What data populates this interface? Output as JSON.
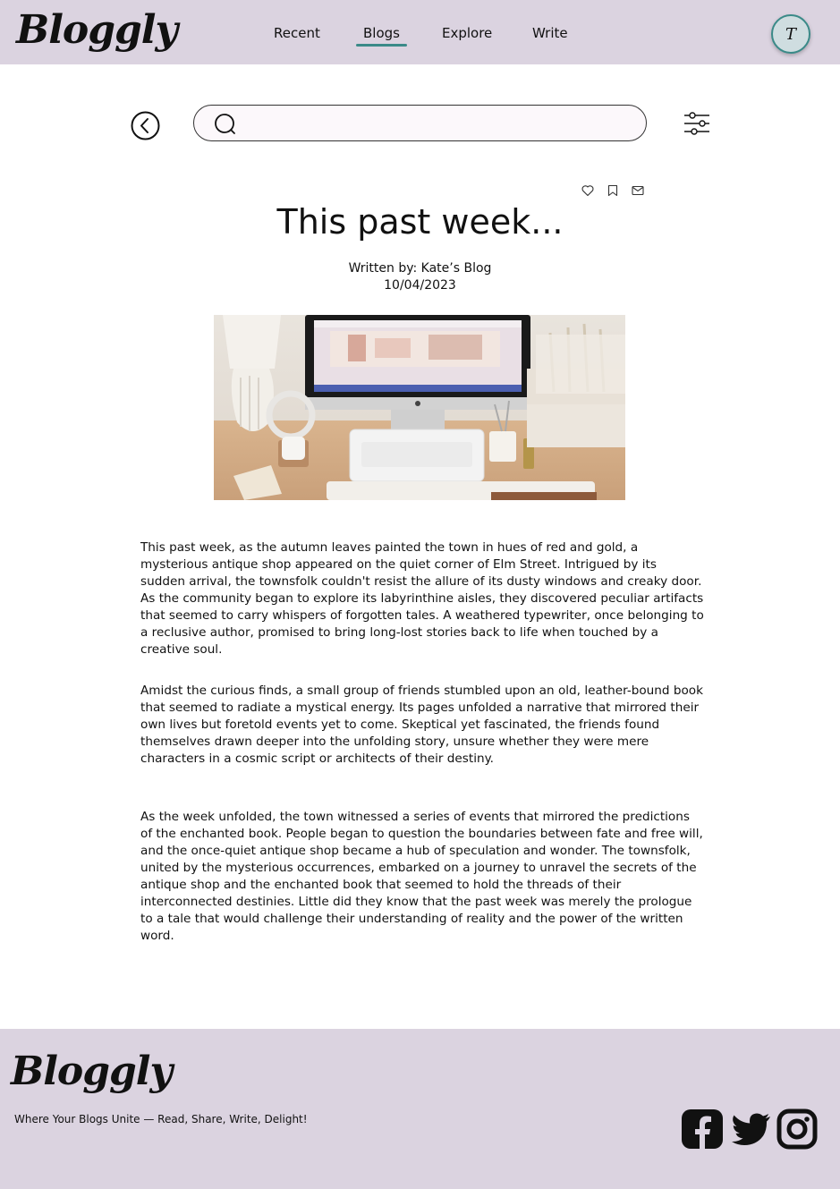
{
  "brand": {
    "logo_text": "Bloggly",
    "accent_color": "#3a8a88",
    "header_bg": "#dbd3e0"
  },
  "nav": {
    "items": [
      {
        "label": "Recent"
      },
      {
        "label": "Blogs",
        "active": true
      },
      {
        "label": "Explore"
      },
      {
        "label": "Write"
      }
    ]
  },
  "user": {
    "avatar_initial": "T"
  },
  "search": {
    "value": "",
    "placeholder": ""
  },
  "icons": {
    "back": "back-circle-icon",
    "search": "search-icon",
    "filter": "sliders-icon",
    "like": "heart-icon",
    "bookmark": "bookmark-icon",
    "share": "mail-icon",
    "facebook": "facebook-icon",
    "twitter": "twitter-icon",
    "instagram": "instagram-icon"
  },
  "article": {
    "title": "This past week...",
    "byline": "Written by: Kate’s Blog",
    "date": "10/04/2023",
    "paragraphs": [
      "This past week, as the autumn leaves painted the town in hues of red and gold, a mysterious antique shop appeared on the quiet corner of Elm Street. Intrigued by its sudden arrival, the townsfolk couldn't resist the allure of its dusty windows and creaky door. As the community began to explore its labyrinthine aisles, they discovered peculiar artifacts that seemed to carry whispers of forgotten tales. A weathered typewriter, once belonging to a reclusive author, promised to bring long-lost stories back to life when touched by a creative soul.",
      "Amidst the curious finds, a small group of friends stumbled upon an old, leather-bound book that seemed to radiate a mystical energy. Its pages unfolded a narrative that mirrored their own lives but foretold events yet to come. Skeptical yet fascinated, the friends found themselves drawn deeper into the unfolding story, unsure whether they were mere characters in a cosmic script or architects of their destiny.",
      "As the week unfolded, the town witnessed a series of events that mirrored the predictions of the enchanted book. People began to question the boundaries between fate and free will, and the once-quiet antique shop became a hub of speculation and wonder. The townsfolk, united by the mysterious occurrences, embarked on a journey to unravel the secrets of the antique shop and the enchanted book that seemed to hold the threads of their interconnected destinies. Little did they know that the past week was merely the prologue to a tale that would challenge their understanding of reality and the power of the written word."
    ]
  },
  "footer": {
    "logo_text": "Bloggly",
    "tagline": "Where Your Blogs Unite — Read, Share, Write, Delight!"
  }
}
